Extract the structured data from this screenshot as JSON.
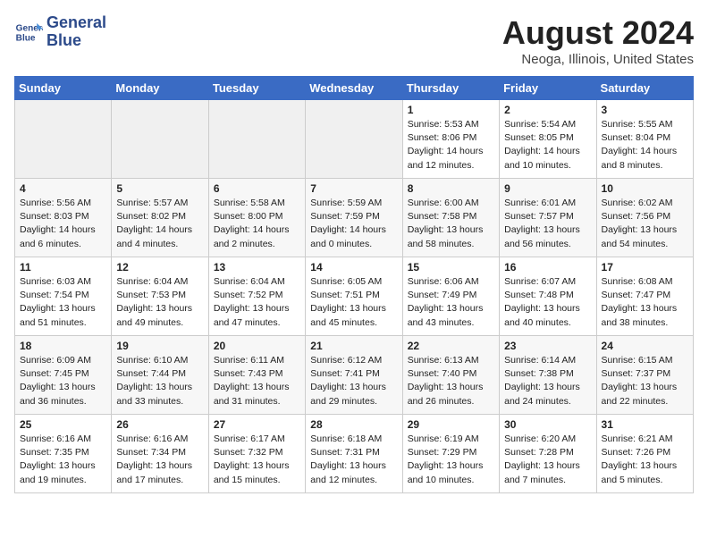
{
  "header": {
    "logo_line1": "General",
    "logo_line2": "Blue",
    "month": "August 2024",
    "location": "Neoga, Illinois, United States"
  },
  "days_of_week": [
    "Sunday",
    "Monday",
    "Tuesday",
    "Wednesday",
    "Thursday",
    "Friday",
    "Saturday"
  ],
  "weeks": [
    [
      {
        "day": "",
        "empty": true
      },
      {
        "day": "",
        "empty": true
      },
      {
        "day": "",
        "empty": true
      },
      {
        "day": "",
        "empty": true
      },
      {
        "day": "1",
        "lines": [
          "Sunrise: 5:53 AM",
          "Sunset: 8:06 PM",
          "Daylight: 14 hours",
          "and 12 minutes."
        ]
      },
      {
        "day": "2",
        "lines": [
          "Sunrise: 5:54 AM",
          "Sunset: 8:05 PM",
          "Daylight: 14 hours",
          "and 10 minutes."
        ]
      },
      {
        "day": "3",
        "lines": [
          "Sunrise: 5:55 AM",
          "Sunset: 8:04 PM",
          "Daylight: 14 hours",
          "and 8 minutes."
        ]
      }
    ],
    [
      {
        "day": "4",
        "lines": [
          "Sunrise: 5:56 AM",
          "Sunset: 8:03 PM",
          "Daylight: 14 hours",
          "and 6 minutes."
        ]
      },
      {
        "day": "5",
        "lines": [
          "Sunrise: 5:57 AM",
          "Sunset: 8:02 PM",
          "Daylight: 14 hours",
          "and 4 minutes."
        ]
      },
      {
        "day": "6",
        "lines": [
          "Sunrise: 5:58 AM",
          "Sunset: 8:00 PM",
          "Daylight: 14 hours",
          "and 2 minutes."
        ]
      },
      {
        "day": "7",
        "lines": [
          "Sunrise: 5:59 AM",
          "Sunset: 7:59 PM",
          "Daylight: 14 hours",
          "and 0 minutes."
        ]
      },
      {
        "day": "8",
        "lines": [
          "Sunrise: 6:00 AM",
          "Sunset: 7:58 PM",
          "Daylight: 13 hours",
          "and 58 minutes."
        ]
      },
      {
        "day": "9",
        "lines": [
          "Sunrise: 6:01 AM",
          "Sunset: 7:57 PM",
          "Daylight: 13 hours",
          "and 56 minutes."
        ]
      },
      {
        "day": "10",
        "lines": [
          "Sunrise: 6:02 AM",
          "Sunset: 7:56 PM",
          "Daylight: 13 hours",
          "and 54 minutes."
        ]
      }
    ],
    [
      {
        "day": "11",
        "lines": [
          "Sunrise: 6:03 AM",
          "Sunset: 7:54 PM",
          "Daylight: 13 hours",
          "and 51 minutes."
        ]
      },
      {
        "day": "12",
        "lines": [
          "Sunrise: 6:04 AM",
          "Sunset: 7:53 PM",
          "Daylight: 13 hours",
          "and 49 minutes."
        ]
      },
      {
        "day": "13",
        "lines": [
          "Sunrise: 6:04 AM",
          "Sunset: 7:52 PM",
          "Daylight: 13 hours",
          "and 47 minutes."
        ]
      },
      {
        "day": "14",
        "lines": [
          "Sunrise: 6:05 AM",
          "Sunset: 7:51 PM",
          "Daylight: 13 hours",
          "and 45 minutes."
        ]
      },
      {
        "day": "15",
        "lines": [
          "Sunrise: 6:06 AM",
          "Sunset: 7:49 PM",
          "Daylight: 13 hours",
          "and 43 minutes."
        ]
      },
      {
        "day": "16",
        "lines": [
          "Sunrise: 6:07 AM",
          "Sunset: 7:48 PM",
          "Daylight: 13 hours",
          "and 40 minutes."
        ]
      },
      {
        "day": "17",
        "lines": [
          "Sunrise: 6:08 AM",
          "Sunset: 7:47 PM",
          "Daylight: 13 hours",
          "and 38 minutes."
        ]
      }
    ],
    [
      {
        "day": "18",
        "lines": [
          "Sunrise: 6:09 AM",
          "Sunset: 7:45 PM",
          "Daylight: 13 hours",
          "and 36 minutes."
        ]
      },
      {
        "day": "19",
        "lines": [
          "Sunrise: 6:10 AM",
          "Sunset: 7:44 PM",
          "Daylight: 13 hours",
          "and 33 minutes."
        ]
      },
      {
        "day": "20",
        "lines": [
          "Sunrise: 6:11 AM",
          "Sunset: 7:43 PM",
          "Daylight: 13 hours",
          "and 31 minutes."
        ]
      },
      {
        "day": "21",
        "lines": [
          "Sunrise: 6:12 AM",
          "Sunset: 7:41 PM",
          "Daylight: 13 hours",
          "and 29 minutes."
        ]
      },
      {
        "day": "22",
        "lines": [
          "Sunrise: 6:13 AM",
          "Sunset: 7:40 PM",
          "Daylight: 13 hours",
          "and 26 minutes."
        ]
      },
      {
        "day": "23",
        "lines": [
          "Sunrise: 6:14 AM",
          "Sunset: 7:38 PM",
          "Daylight: 13 hours",
          "and 24 minutes."
        ]
      },
      {
        "day": "24",
        "lines": [
          "Sunrise: 6:15 AM",
          "Sunset: 7:37 PM",
          "Daylight: 13 hours",
          "and 22 minutes."
        ]
      }
    ],
    [
      {
        "day": "25",
        "lines": [
          "Sunrise: 6:16 AM",
          "Sunset: 7:35 PM",
          "Daylight: 13 hours",
          "and 19 minutes."
        ]
      },
      {
        "day": "26",
        "lines": [
          "Sunrise: 6:16 AM",
          "Sunset: 7:34 PM",
          "Daylight: 13 hours",
          "and 17 minutes."
        ]
      },
      {
        "day": "27",
        "lines": [
          "Sunrise: 6:17 AM",
          "Sunset: 7:32 PM",
          "Daylight: 13 hours",
          "and 15 minutes."
        ]
      },
      {
        "day": "28",
        "lines": [
          "Sunrise: 6:18 AM",
          "Sunset: 7:31 PM",
          "Daylight: 13 hours",
          "and 12 minutes."
        ]
      },
      {
        "day": "29",
        "lines": [
          "Sunrise: 6:19 AM",
          "Sunset: 7:29 PM",
          "Daylight: 13 hours",
          "and 10 minutes."
        ]
      },
      {
        "day": "30",
        "lines": [
          "Sunrise: 6:20 AM",
          "Sunset: 7:28 PM",
          "Daylight: 13 hours",
          "and 7 minutes."
        ]
      },
      {
        "day": "31",
        "lines": [
          "Sunrise: 6:21 AM",
          "Sunset: 7:26 PM",
          "Daylight: 13 hours",
          "and 5 minutes."
        ]
      }
    ]
  ]
}
